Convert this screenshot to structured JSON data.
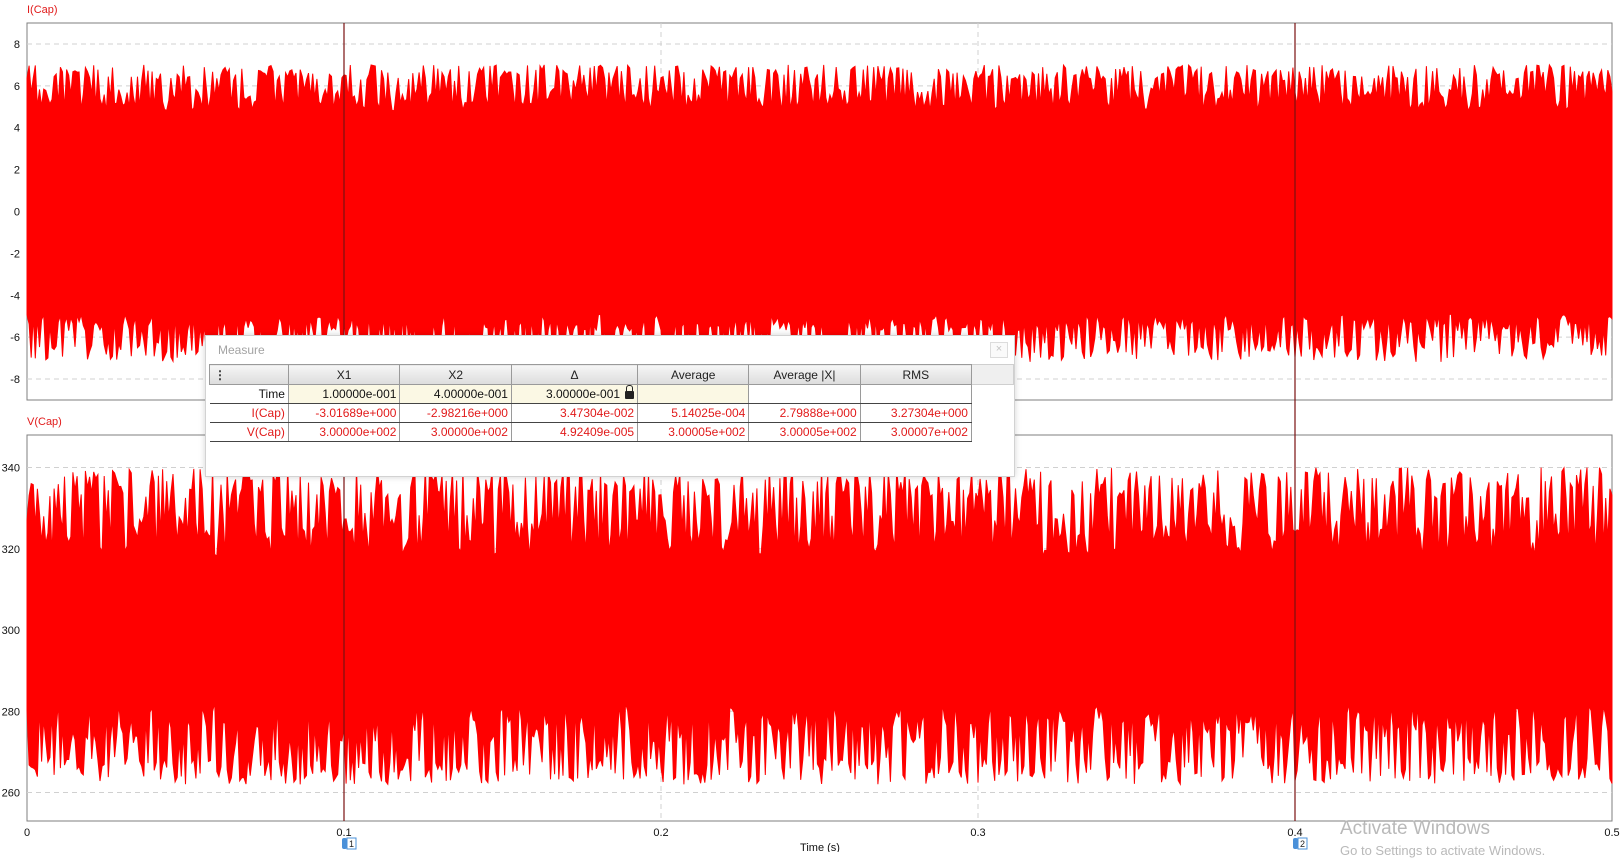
{
  "chart_data": [
    {
      "type": "line",
      "series": [
        {
          "name": "I(Cap)",
          "color": "#ff0000"
        }
      ],
      "x_range": [
        0,
        0.5
      ],
      "ylim": [
        -9,
        9
      ],
      "y_ticks": [
        "8",
        "6",
        "4",
        "2",
        "0",
        "-2",
        "-4",
        "-6",
        "-8"
      ],
      "envelope": {
        "upper": [
          4.8,
          7.0
        ],
        "lower": [
          -4.9,
          -7.2
        ]
      },
      "grid": true
    },
    {
      "type": "line",
      "series": [
        {
          "name": "V(Cap)",
          "color": "#ff0000"
        }
      ],
      "x_range": [
        0,
        0.5
      ],
      "ylim": [
        253,
        348
      ],
      "y_ticks": [
        "340",
        "320",
        "300",
        "280",
        "260"
      ],
      "envelope": {
        "upper": [
          318,
          340
        ],
        "lower": [
          262,
          282
        ]
      },
      "grid": true
    }
  ],
  "x_axis": {
    "label": "Time (s)",
    "ticks": [
      "0",
      "0.1",
      "0.2",
      "0.3",
      "0.4",
      "0.5"
    ],
    "tick_values": [
      0,
      0.1,
      0.2,
      0.3,
      0.4,
      0.5
    ]
  },
  "cursors": [
    {
      "label": "1",
      "time": 0.1,
      "color": "#7a1010"
    },
    {
      "label": "2",
      "time": 0.4,
      "color": "#7a1010"
    }
  ],
  "measure": {
    "title": "Measure",
    "close_label": "×",
    "menu_label": "⋮",
    "columns": [
      "X1",
      "X2",
      "Δ",
      "Average",
      "Average |X|",
      "RMS"
    ],
    "rows": [
      {
        "label": "Time",
        "values": [
          "1.00000e-001",
          "4.00000e-001",
          "3.00000e-001",
          "",
          "",
          ""
        ]
      },
      {
        "label": "I(Cap)",
        "values": [
          "-3.01689e+000",
          "-2.98216e+000",
          "3.47304e-002",
          "5.14025e-004",
          "2.79888e+000",
          "3.27304e+000"
        ]
      },
      {
        "label": "V(Cap)",
        "values": [
          "3.00000e+002",
          "3.00000e+002",
          "4.92409e-005",
          "3.00005e+002",
          "3.00005e+002",
          "3.00007e+002"
        ]
      }
    ]
  },
  "watermark": {
    "line1": "Activate Windows",
    "line2": "Go to Settings to activate Windows."
  }
}
